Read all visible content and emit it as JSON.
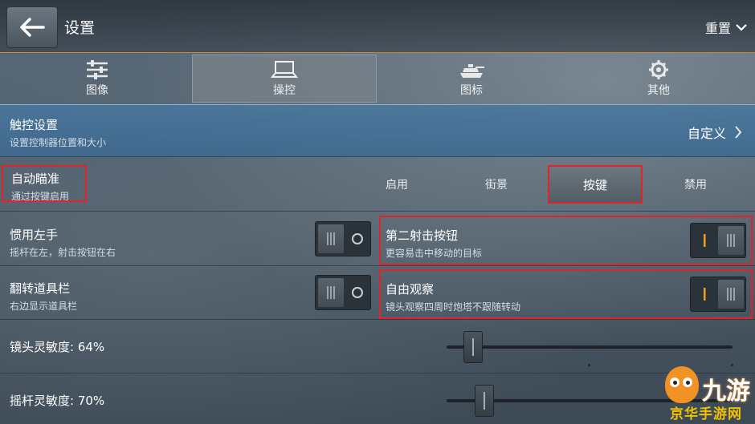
{
  "header": {
    "title": "设置",
    "reset_label": "重置"
  },
  "tabs": [
    {
      "label": "图像",
      "icon": "sliders-icon"
    },
    {
      "label": "操控",
      "icon": "laptop-icon",
      "active": true
    },
    {
      "label": "图标",
      "icon": "tank-icon"
    },
    {
      "label": "其他",
      "icon": "gear-icon"
    }
  ],
  "touch": {
    "title": "触控设置",
    "subtitle": "设置控制器位置和大小",
    "value": "自定义"
  },
  "auto_aim": {
    "title": "自动瞄准",
    "subtitle": "通过按键启用",
    "options": [
      "启用",
      "街景",
      "按键",
      "禁用"
    ],
    "selected": "按键"
  },
  "left_hand": {
    "title": "惯用左手",
    "subtitle": "摇杆在左，射击按钮在右",
    "on": false
  },
  "second_fire": {
    "title": "第二射击按钮",
    "subtitle": "更容易击中移动的目标",
    "on": true
  },
  "flip_toolbar": {
    "title": "翻转道具栏",
    "subtitle": "右边显示道具栏",
    "on": false
  },
  "free_look": {
    "title": "自由观察",
    "subtitle": "镜头观察四周时炮塔不跟随转动",
    "on": true
  },
  "camera_sensitivity": {
    "label": "镜头灵敏度: 64%",
    "value": 64
  },
  "joystick_sensitivity": {
    "label": "摇杆灵敏度: 70%",
    "value": 70
  },
  "watermark": {
    "text": "九游",
    "bottom": "京华手游网"
  },
  "colors": {
    "accent_red": "#e1242a",
    "toggle_on": "#f0a020",
    "touch_bg": "#4678a0"
  }
}
